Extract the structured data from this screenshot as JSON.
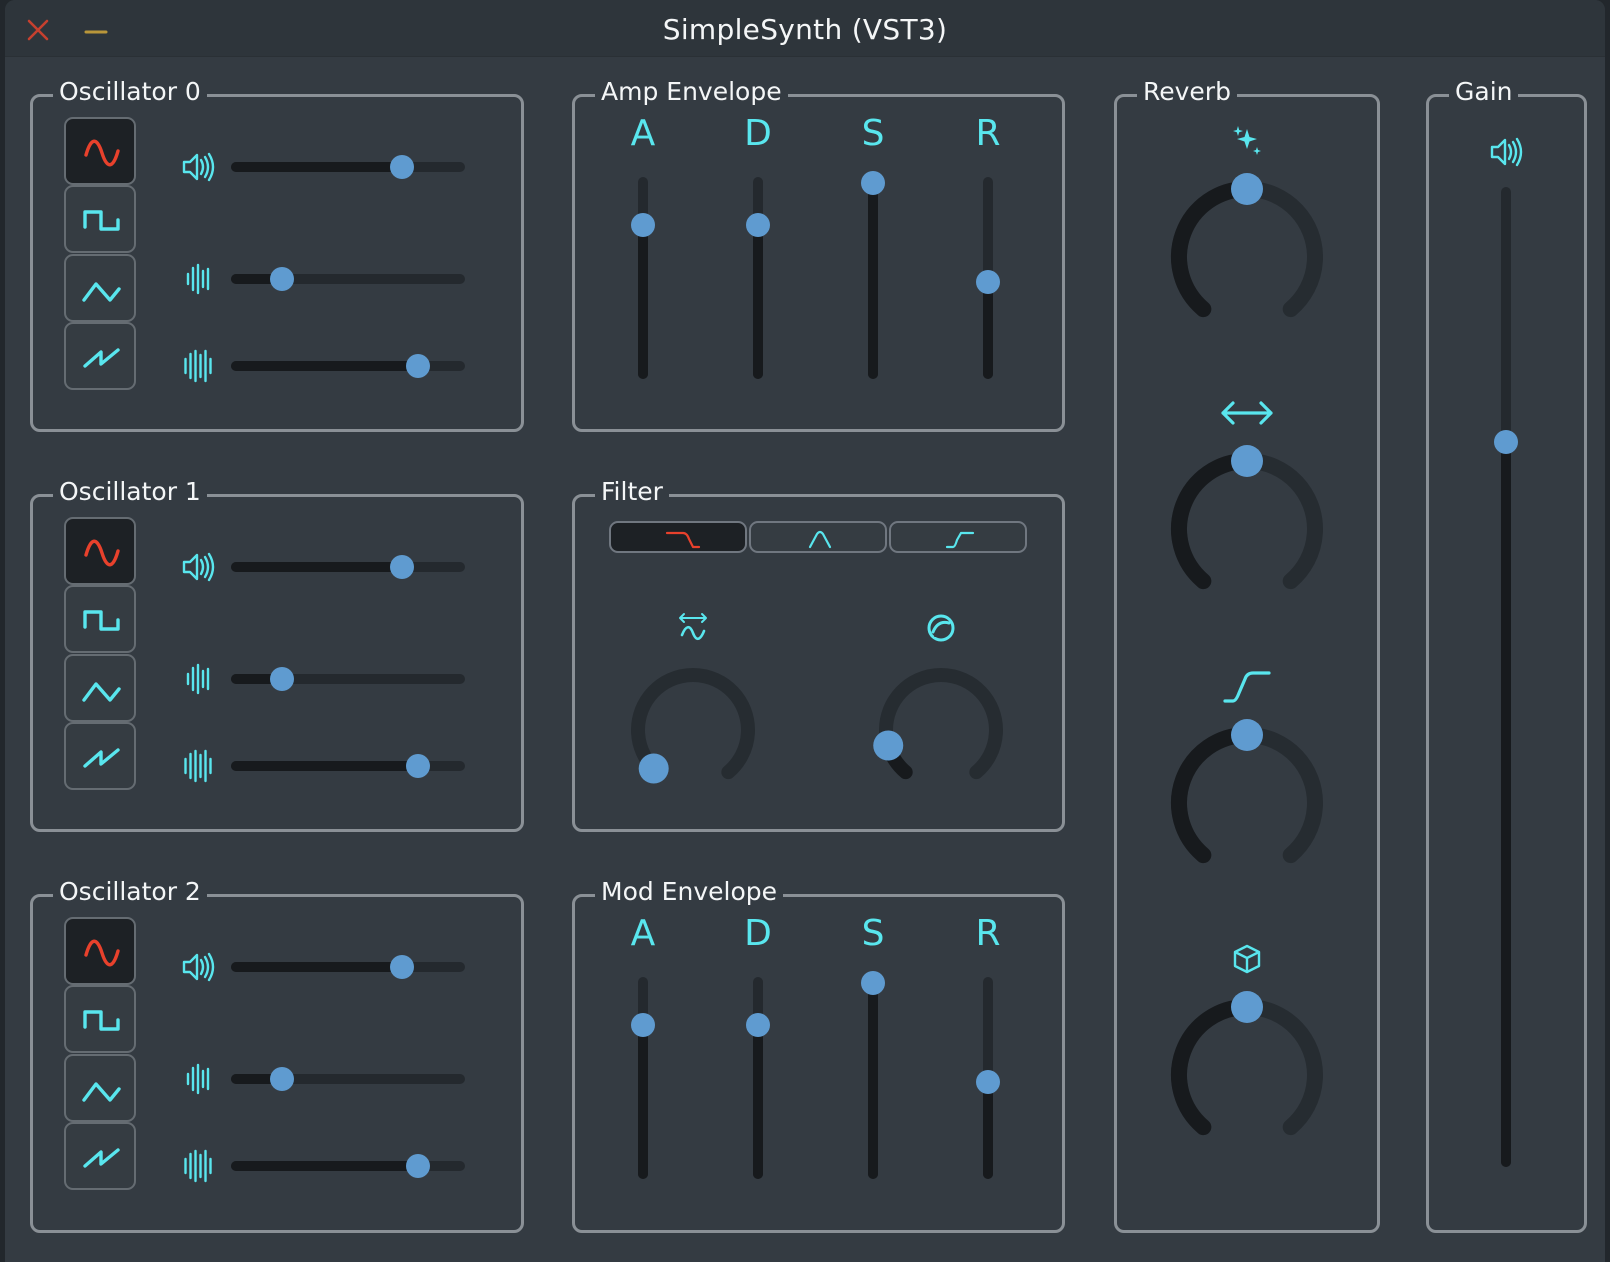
{
  "window": {
    "title": "SimpleSynth (VST3)"
  },
  "colors": {
    "accent": "#59e6ee",
    "thumb": "#5f9bd0",
    "selected_wave": "#e8412c",
    "close": "#c6402f",
    "minimize": "#b9963a"
  },
  "oscillators": [
    {
      "title": "Oscillator 0",
      "selected_wave": "sine",
      "waves": [
        "sine",
        "square",
        "triangle",
        "saw"
      ],
      "sliders": [
        {
          "icon": "volume-icon",
          "value": 0.73
        },
        {
          "icon": "detune-waveform-icon",
          "value": 0.22
        },
        {
          "icon": "unison-waveform-icon",
          "value": 0.8
        }
      ]
    },
    {
      "title": "Oscillator 1",
      "selected_wave": "sine",
      "waves": [
        "sine",
        "square",
        "triangle",
        "saw"
      ],
      "sliders": [
        {
          "icon": "volume-icon",
          "value": 0.73
        },
        {
          "icon": "detune-waveform-icon",
          "value": 0.22
        },
        {
          "icon": "unison-waveform-icon",
          "value": 0.8
        }
      ]
    },
    {
      "title": "Oscillator 2",
      "selected_wave": "sine",
      "waves": [
        "sine",
        "square",
        "triangle",
        "saw"
      ],
      "sliders": [
        {
          "icon": "volume-icon",
          "value": 0.73
        },
        {
          "icon": "detune-waveform-icon",
          "value": 0.22
        },
        {
          "icon": "unison-waveform-icon",
          "value": 0.8
        }
      ]
    }
  ],
  "amp_envelope": {
    "title": "Amp Envelope",
    "params": [
      {
        "label": "A",
        "value": 0.76
      },
      {
        "label": "D",
        "value": 0.76
      },
      {
        "label": "S",
        "value": 0.97
      },
      {
        "label": "R",
        "value": 0.48
      }
    ]
  },
  "mod_envelope": {
    "title": "Mod Envelope",
    "params": [
      {
        "label": "A",
        "value": 0.76
      },
      {
        "label": "D",
        "value": 0.76
      },
      {
        "label": "S",
        "value": 0.97
      },
      {
        "label": "R",
        "value": 0.48
      }
    ]
  },
  "filter": {
    "title": "Filter",
    "modes": [
      "lowpass",
      "bandpass",
      "highpass"
    ],
    "selected_mode": "lowpass",
    "knobs": [
      {
        "icon": "cutoff-icon",
        "value": 0.02
      },
      {
        "icon": "resonance-icon",
        "value": 0.12
      }
    ]
  },
  "reverb": {
    "title": "Reverb",
    "knobs": [
      {
        "icon": "sparkle-icon",
        "value": 0.5
      },
      {
        "icon": "width-arrows-icon",
        "value": 0.5
      },
      {
        "icon": "damping-curve-icon",
        "value": 0.5
      },
      {
        "icon": "room-cube-icon",
        "value": 0.5
      }
    ]
  },
  "gain": {
    "title": "Gain",
    "icon": "volume-icon",
    "value": 0.74
  }
}
